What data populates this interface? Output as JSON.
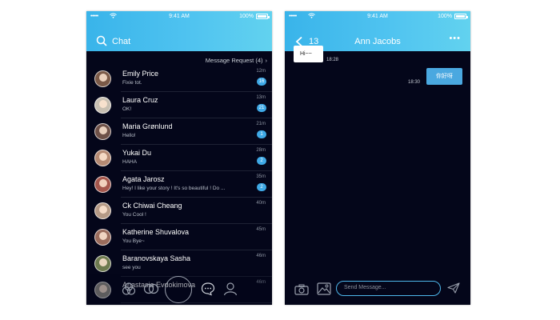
{
  "status_bar": {
    "signal": "•••••",
    "time": "9:41 AM",
    "battery": "100%"
  },
  "chat_list_screen": {
    "title": "Chat",
    "message_request": "Message Request (4)",
    "chats": [
      {
        "name": "Emily Price",
        "preview": "Fixie tot.",
        "time": "12m",
        "badge": "16",
        "avatar_color": "#7b5a48"
      },
      {
        "name": "Laura Cruz",
        "preview": "OK!",
        "time": "13m",
        "badge": "21",
        "avatar_color": "#c7bfb1"
      },
      {
        "name": "Maria Grønlund",
        "preview": "Hello!",
        "time": "21m",
        "badge": "1",
        "avatar_color": "#6e5148"
      },
      {
        "name": "Yukai Du",
        "preview": "HAHA",
        "time": "28m",
        "badge": "2",
        "avatar_color": "#b58a73"
      },
      {
        "name": "Agata Jarosz",
        "preview": "Hey! I like your story ! It's so beautiful ! Do ...",
        "time": "35m",
        "badge": "2",
        "avatar_color": "#a4564c"
      },
      {
        "name": "Ck Chiwai Cheang",
        "preview": "You Cool !",
        "time": "40m",
        "badge": "",
        "avatar_color": "#b59a86"
      },
      {
        "name": "Katherine Shuvalova",
        "preview": "You Bye~",
        "time": "45m",
        "badge": "",
        "avatar_color": "#9a6c5c"
      },
      {
        "name": "Baranovskaya Sasha",
        "preview": "see you",
        "time": "46m",
        "badge": "",
        "avatar_color": "#6d7a4f"
      },
      {
        "name": "Anastasia Evdokimova",
        "preview": "",
        "time": "46m",
        "badge": "",
        "avatar_color": "#8e8a82"
      }
    ],
    "tab_icons": [
      "discover-icon",
      "friends-icon",
      "home-button",
      "chat-icon",
      "profile-icon"
    ]
  },
  "chat_detail_screen": {
    "back_count": "13",
    "contact_name": "Ann Jacobs",
    "more": "•••",
    "messages": [
      {
        "direction": "in",
        "text": "Hi~~",
        "time": "18:28"
      },
      {
        "direction": "out",
        "text": "你好呀",
        "time": "18:30"
      }
    ],
    "input_placeholder": "Send Message...",
    "colors": {
      "header_start": "#39b4ea",
      "header_end": "#62d2ef",
      "background": "#04061a",
      "accent": "#4aa8e0",
      "badge": "#3fa9e6"
    }
  }
}
